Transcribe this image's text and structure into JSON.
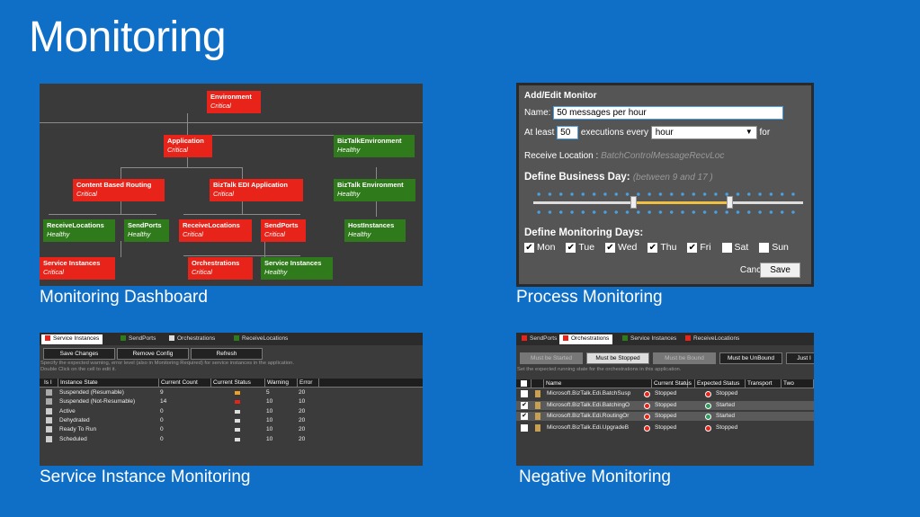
{
  "page": {
    "title": "Monitoring"
  },
  "captions": {
    "dashboard": "Monitoring Dashboard",
    "process": "Process Monitoring",
    "sim": "Service Instance Monitoring",
    "negative": "Negative Monitoring"
  },
  "colors": {
    "background": "#0f6fc6",
    "critical": "#e8241a",
    "healthy": "#2f7a1a"
  },
  "dashboard": {
    "nodes": [
      {
        "name": "Environment",
        "status": "Critical"
      },
      {
        "name": "Application",
        "status": "Critical"
      },
      {
        "name": "BizTalkEnvironment",
        "status": "Healthy"
      },
      {
        "name": "Content Based Routing",
        "status": "Critical"
      },
      {
        "name": "BizTalk EDI Application",
        "status": "Critical"
      },
      {
        "name": "BizTalk Environment",
        "status": "Healthy"
      },
      {
        "name": "ReceiveLocations",
        "status": "Healthy"
      },
      {
        "name": "SendPorts",
        "status": "Healthy"
      },
      {
        "name": "ReceiveLocations",
        "status": "Critical"
      },
      {
        "name": "SendPorts",
        "status": "Critical"
      },
      {
        "name": "HostInstances",
        "status": "Healthy"
      },
      {
        "name": "Service Instances",
        "status": "Critical"
      },
      {
        "name": "Orchestrations",
        "status": "Critical"
      },
      {
        "name": "Service Instances",
        "status": "Healthy"
      }
    ]
  },
  "process": {
    "heading": "Add/Edit Monitor",
    "name_label": "Name:",
    "name_value": "50 messages per hour",
    "atleast_label": "At least",
    "count_value": "50",
    "executions_label": "executions every",
    "period_value": "hour",
    "for_label": "for",
    "receive_label": "Receive Location :",
    "receive_value": "BatchControlMessageRecvLoc",
    "business_label": "Define Business Day:",
    "business_hint": "(between  9  and  17  )",
    "days_label": "Define Monitoring Days:",
    "days": [
      {
        "label": "Mon",
        "checked": true
      },
      {
        "label": "Tue",
        "checked": true
      },
      {
        "label": "Wed",
        "checked": true
      },
      {
        "label": "Thu",
        "checked": true
      },
      {
        "label": "Fri",
        "checked": true
      },
      {
        "label": "Sat",
        "checked": false
      },
      {
        "label": "Sun",
        "checked": false
      }
    ],
    "cancel": "Cancel",
    "save": "Save"
  },
  "sim": {
    "tabs": [
      "Service Instances",
      "SendPorts",
      "Orchestrations",
      "ReceiveLocations"
    ],
    "buttons": [
      "Save Changes",
      "Remove Config",
      "Refresh"
    ],
    "hint1": "Specify the expected warning, error level (also in Monitoring Required) for service instances in the application.",
    "hint2": "Double Click on the cell to edit it.",
    "headers": [
      "Is I",
      "Instance State",
      "Current Count",
      "Current Status",
      "Warning",
      "Error"
    ],
    "rows": [
      {
        "state": "Suspended (Resumable)",
        "count": "9",
        "warning": "5",
        "error": "20",
        "checked": true,
        "status_color": "#f0a020"
      },
      {
        "state": "Suspended (Not-Resumable)",
        "count": "14",
        "warning": "10",
        "error": "10",
        "checked": true,
        "status_color": "#e8241a"
      },
      {
        "state": "Active",
        "count": "0",
        "warning": "10",
        "error": "20",
        "checked": false,
        "status_color": "#dddddd"
      },
      {
        "state": "Dehydrated",
        "count": "0",
        "warning": "10",
        "error": "20",
        "checked": false,
        "status_color": "#dddddd"
      },
      {
        "state": "Ready To Run",
        "count": "0",
        "warning": "10",
        "error": "20",
        "checked": false,
        "status_color": "#dddddd"
      },
      {
        "state": "Scheduled",
        "count": "0",
        "warning": "10",
        "error": "20",
        "checked": false,
        "status_color": "#dddddd"
      }
    ]
  },
  "neg": {
    "tabs": [
      "SendPorts",
      "Orchestrations",
      "Service Instances",
      "ReceiveLocations"
    ],
    "buttons": [
      "Must be Started",
      "Must be Stopped",
      "Must be Bound",
      "Must be UnBound",
      "Just I"
    ],
    "hint": "Set the expected running state for the orchestrations in this application.",
    "headers": [
      "",
      "Name",
      "Current Status",
      "Expected Status",
      "Transport",
      "Two"
    ],
    "rows": [
      {
        "name": "Microsoft.BizTalk.Edi.BatchSusp",
        "current": "Stopped",
        "expected": "Stopped",
        "checked": false
      },
      {
        "name": "Microsoft.BizTalk.Edi.BatchingO",
        "current": "Stopped",
        "expected": "Started",
        "checked": true
      },
      {
        "name": "Microsoft.BizTalk.Edi.RoutingOr",
        "current": "Stopped",
        "expected": "Started",
        "checked": true
      },
      {
        "name": "Microsoft.BizTalk.Edi.UpgradeB",
        "current": "Stopped",
        "expected": "Stopped",
        "checked": false
      }
    ]
  }
}
